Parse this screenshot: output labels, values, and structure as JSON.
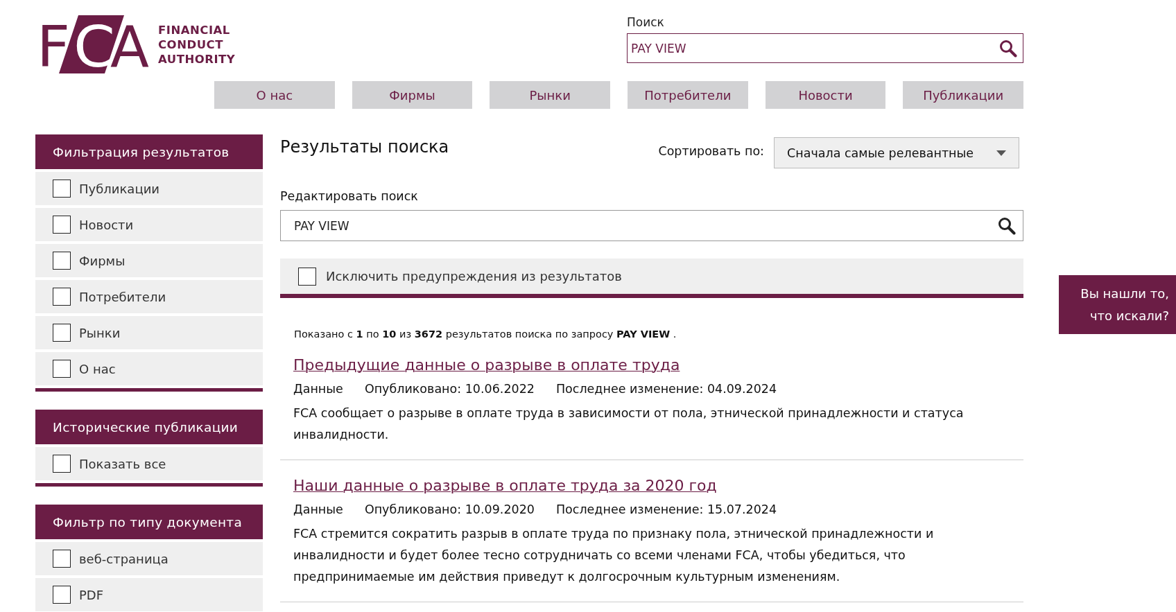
{
  "logo": {
    "mark": "FCA",
    "name_lines": [
      "FINANCIAL",
      "CONDUCT",
      "AUTHORITY"
    ]
  },
  "header_search": {
    "label": "Поиск",
    "value": "PAY VIEW"
  },
  "nav": [
    {
      "label": "О нас"
    },
    {
      "label": "Фирмы"
    },
    {
      "label": "Рынки"
    },
    {
      "label": "Потребители"
    },
    {
      "label": "Новости"
    },
    {
      "label": "Публикации"
    }
  ],
  "sidebar": [
    {
      "title": "Фильтрация результатов",
      "items": [
        {
          "label": "Публикации",
          "checked": false
        },
        {
          "label": "Новости",
          "checked": false
        },
        {
          "label": "Фирмы",
          "checked": false
        },
        {
          "label": "Потребители",
          "checked": false
        },
        {
          "label": "Рынки",
          "checked": false
        },
        {
          "label": "О нас",
          "checked": false
        }
      ]
    },
    {
      "title": "Исторические публикации",
      "items": [
        {
          "label": "Показать все",
          "checked": false
        }
      ]
    },
    {
      "title": "Фильтр по типу документа",
      "items": [
        {
          "label": "веб-страница",
          "checked": false
        },
        {
          "label": "PDF",
          "checked": false
        }
      ]
    }
  ],
  "results_title": "Результаты поиска",
  "sort": {
    "label": "Сортировать по:",
    "value": "Сначала самые релевантные"
  },
  "edit_search": {
    "label": "Редактировать поиск",
    "value": "PAY VIEW"
  },
  "exclude_warnings": {
    "label": "Исключить предупреждения из результатов",
    "checked": false
  },
  "summary": "Показано с **1** по **10** из **3672** результатов поиска по запросу **PAY VIEW** .",
  "results": [
    {
      "title": "Предыдущие данные о разрыве в оплате труда",
      "type": "Данные",
      "published": "Опубликовано: 10.06.2022",
      "modified": "Последнее изменение: 04.09.2024",
      "description": "FCA сообщает о разрыве в оплате труда в зависимости от пола, этнической принадлежности и статуса инвалидности."
    },
    {
      "title": "Наши данные о разрыве в оплате труда за 2020 год",
      "type": "Данные",
      "published": "Опубликовано: 10.09.2020",
      "modified": "Последнее изменение: 15.07.2024",
      "description": "FCA стремится сократить разрыв в оплате труда по признаку пола, этнической принадлежности и инвалидности и будет более тесно сотрудничать со всеми членами FCA, чтобы убедиться, что предпринимаемые им действия приведут к долгосрочным культурным изменениям."
    }
  ],
  "feedback_tab": {
    "lines": [
      "Вы нашли то,",
      "что искали?"
    ]
  }
}
